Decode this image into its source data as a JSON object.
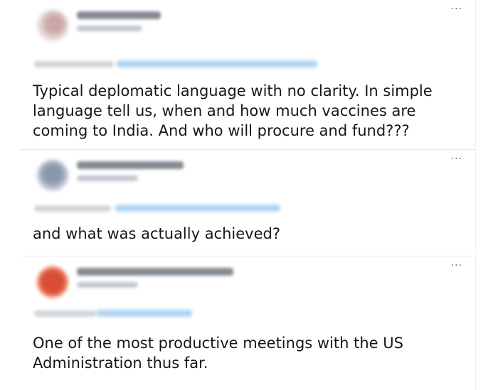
{
  "replies": [
    {
      "text": "Typical deplomatic language with no clarity. In simple language tell us, when and how much vaccines are coming to India. And who will procure and fund???",
      "more_label": "···"
    },
    {
      "text": "and what was actually achieved?",
      "more_label": "···"
    },
    {
      "text": "One of the most productive meetings with the US Administration thus far.",
      "more_label": "···"
    }
  ]
}
